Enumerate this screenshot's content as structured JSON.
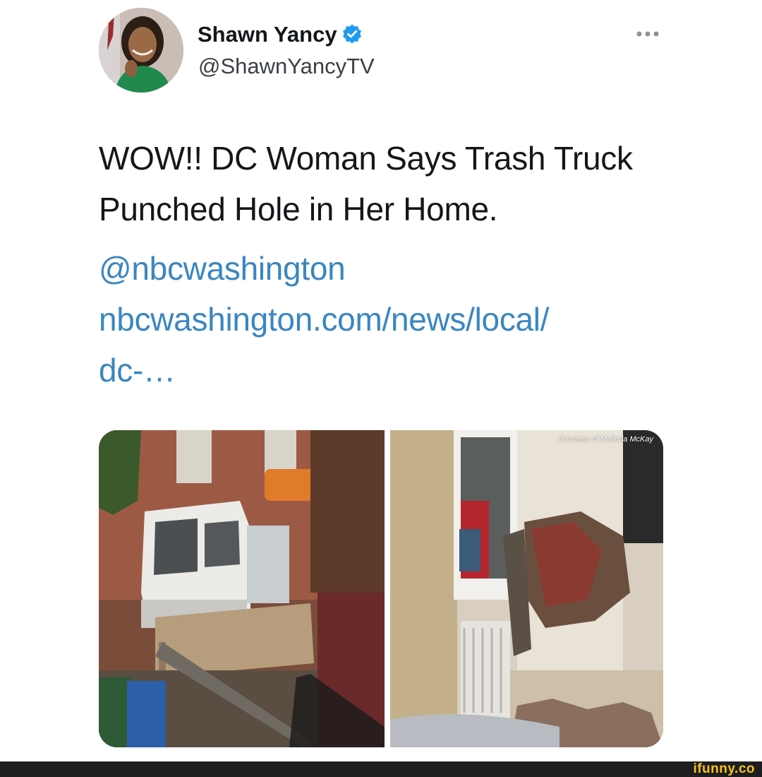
{
  "author": {
    "display_name": "Shawn Yancy",
    "handle": "@ShawnYancyTV",
    "verified": true,
    "verified_color": "#1d9bf0"
  },
  "tweet": {
    "text": "WOW!! DC Woman Says Trash Truck Punched Hole in Her Home.",
    "mention": "@nbcwashington",
    "link_line1": "nbcwashington.com/news/local/",
    "link_line2": "dc-…",
    "link_color": "#3a86c0"
  },
  "media": {
    "left_image": "photo of a white trash truck crashed through a fence next to a brick building",
    "right_image": "photo of a room with a hole punched in the wall beside a window and radiator",
    "credit": "Courtesy of Melinda McKay"
  },
  "watermark": {
    "text": "ifunny.co",
    "color": "#f7c31a"
  },
  "icons": {
    "more": "more-dots-icon",
    "verified": "verified-badge-icon"
  }
}
